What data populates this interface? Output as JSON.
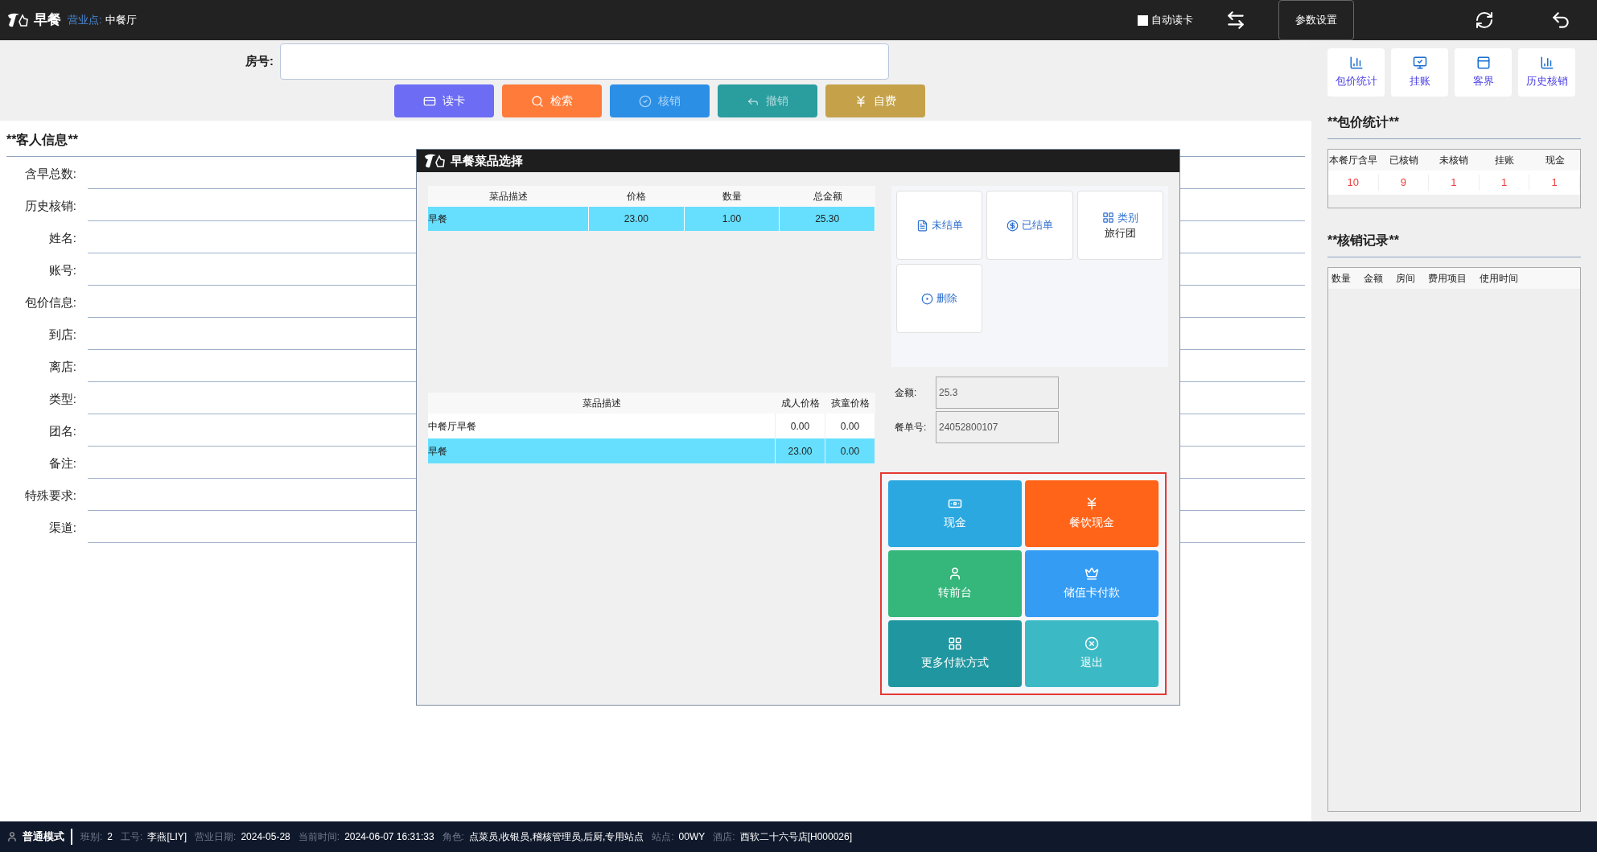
{
  "topbar": {
    "app_title": "早餐",
    "outlet_label": "营业点:",
    "outlet": "中餐厅",
    "auto_read": {
      "label": "自动读卡",
      "checked": false
    },
    "settings_button": "参数设置"
  },
  "search": {
    "label": "房号:"
  },
  "actions": [
    {
      "label": "读卡",
      "color": "#6c6cf5",
      "disabled": false
    },
    {
      "label": "检索",
      "color": "#ff7b3a",
      "disabled": false
    },
    {
      "label": "核销",
      "color": "#2b8fe6",
      "disabled": true
    },
    {
      "label": "撤销",
      "color": "#2a9d9f",
      "disabled": true
    },
    {
      "label": "自费",
      "color": "#c5a24a",
      "disabled": false
    }
  ],
  "guest_info": {
    "title": "**客人信息**",
    "fields": [
      "含早总数:",
      "历史核销:",
      "姓名:",
      "账号:",
      "包价信息:",
      "到店:",
      "离店:",
      "类型:",
      "团名:",
      "备注:",
      "特殊要求:",
      "渠道:"
    ]
  },
  "right_buttons": [
    "包价统计",
    "挂账",
    "客界",
    "历史核销"
  ],
  "package_stats": {
    "title": "**包价统计**",
    "columns": [
      "本餐厅含早",
      "已核销",
      "未核销",
      "挂账",
      "现金"
    ],
    "values": [
      "10",
      "9",
      "1",
      "1",
      "1"
    ]
  },
  "writeoff_records": {
    "title": "**核销记录**",
    "columns": [
      "数量",
      "金额",
      "房间",
      "费用项目",
      "使用时间"
    ]
  },
  "dialog": {
    "title": "早餐菜品选择",
    "order_table": {
      "columns": [
        "菜品描述",
        "价格",
        "数量",
        "总金额"
      ],
      "rows": [
        {
          "cells": [
            "早餐",
            "23.00",
            "1.00",
            "25.30"
          ],
          "selected": true
        }
      ]
    },
    "menu_table": {
      "columns": [
        "菜品描述",
        "成人价格",
        "孩童价格"
      ],
      "rows": [
        {
          "cells": [
            "中餐厅早餐",
            "0.00",
            "0.00"
          ],
          "selected": false
        },
        {
          "cells": [
            "早餐",
            "23.00",
            "0.00"
          ],
          "selected": true
        }
      ]
    },
    "tiles": [
      {
        "label": "未结单"
      },
      {
        "label": "已结单"
      },
      {
        "label": "类别",
        "sub": "旅行团"
      },
      {
        "label": "删除"
      }
    ],
    "amount": {
      "label": "金额:",
      "value": "25.3"
    },
    "order_no": {
      "label": "餐单号:",
      "value": "24052800107"
    },
    "payments": [
      {
        "label": "现金",
        "color": "#2ba8e0"
      },
      {
        "label": "餐饮现金",
        "color": "#ff6418"
      },
      {
        "label": "转前台",
        "color": "#35b67b"
      },
      {
        "label": "储值卡付款",
        "color": "#359cf3"
      },
      {
        "label": "更多付款方式",
        "color": "#2097a0"
      },
      {
        "label": "退出",
        "color": "#3bbac6"
      }
    ]
  },
  "status_bar": {
    "mode": "普通模式",
    "items": [
      {
        "label": "班别:",
        "value": "2"
      },
      {
        "label": "工号:",
        "value": "李燕[LIY]"
      },
      {
        "label": "营业日期:",
        "value": "2024-05-28"
      },
      {
        "label": "当前时间:",
        "value": "2024-06-07 16:31:33"
      },
      {
        "label": "角色:",
        "value": "点菜员,收银员,稽核管理员,后厨,专用站点"
      },
      {
        "label": "站点:",
        "value": "00WY"
      },
      {
        "label": "酒店:",
        "value": "西软二十六号店[H000026]"
      }
    ]
  }
}
